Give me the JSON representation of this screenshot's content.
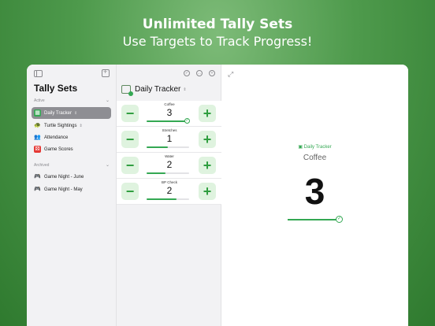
{
  "hero": {
    "title": "Unlimited Tally Sets",
    "subtitle": "Use Targets to Track Progress!"
  },
  "sidebar": {
    "title": "Tally Sets",
    "active_label": "Active",
    "archived_label": "Archived",
    "active_items": [
      {
        "label": "Daily Tracker",
        "icon": "calendar-icon",
        "selected": true
      },
      {
        "label": "Turtle Sightings",
        "icon": "turtle-icon"
      },
      {
        "label": "Attendance",
        "icon": "people-icon"
      },
      {
        "label": "Game Scores",
        "icon": "dice-icon"
      }
    ],
    "archived_items": [
      {
        "label": "Game Night - June",
        "icon": "gamepad-icon"
      },
      {
        "label": "Game Night - May",
        "icon": "gamepad-icon"
      }
    ]
  },
  "middle": {
    "title": "Daily Tracker",
    "minus": "−",
    "plus": "+",
    "tallies": [
      {
        "name": "Coffee",
        "value": "3",
        "progress": 1.0,
        "complete": true
      },
      {
        "name": "Stretches",
        "value": "1",
        "progress": 0.5
      },
      {
        "name": "Water",
        "value": "2",
        "progress": 0.45
      },
      {
        "name": "BP Check",
        "value": "2",
        "progress": 0.7
      }
    ]
  },
  "detail": {
    "set_name": "Daily Tracker",
    "tally_name": "Coffee",
    "value": "3",
    "progress": 1.0
  },
  "colors": {
    "accent": "#34a853",
    "button_bg": "#dff3df",
    "selected_bg": "#8e8e93"
  }
}
